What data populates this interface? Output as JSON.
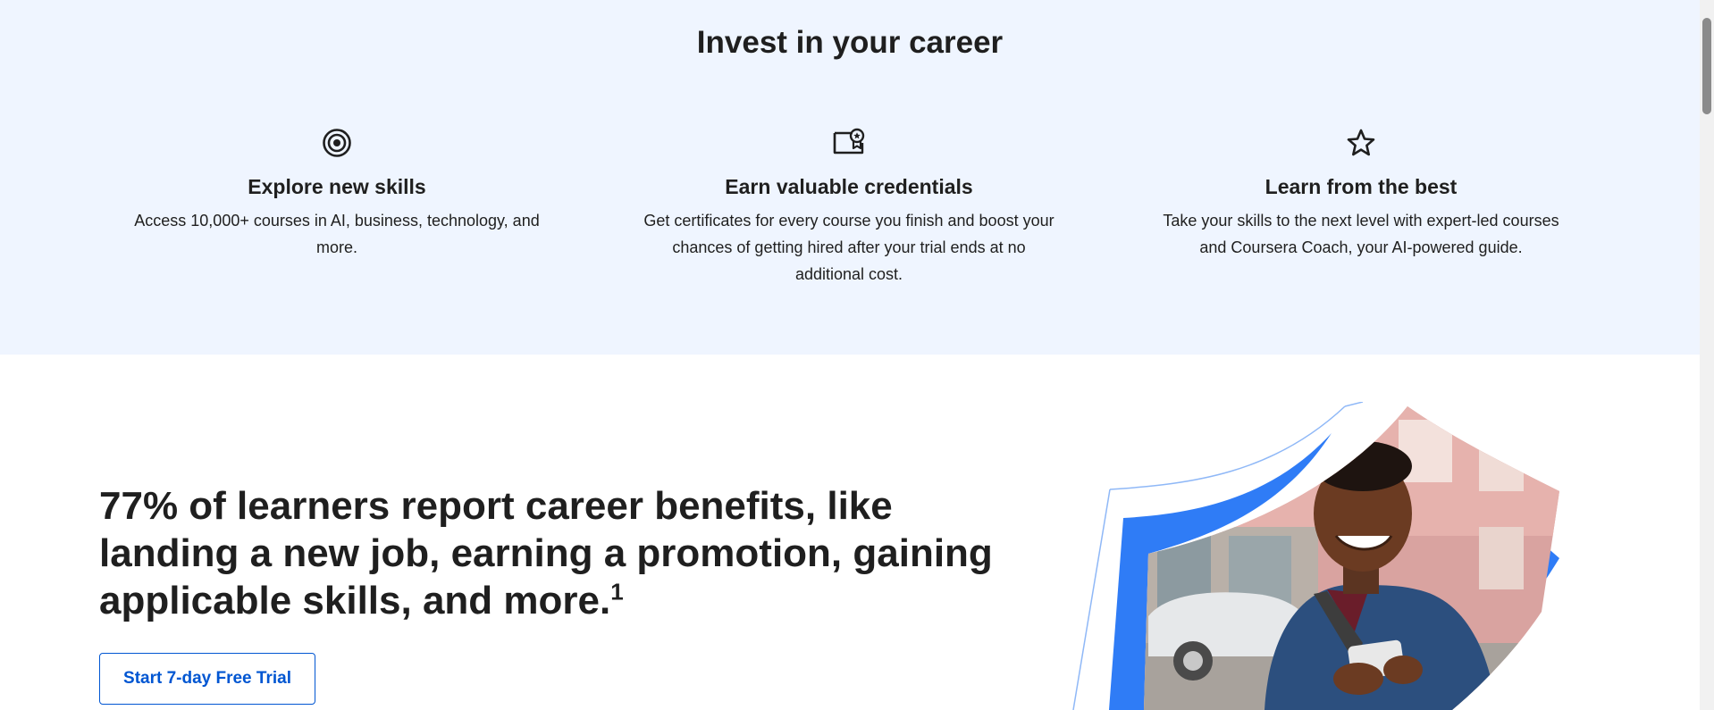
{
  "invest": {
    "title": "Invest in your career",
    "features": [
      {
        "icon": "target-icon",
        "title": "Explore new skills",
        "description": "Access 10,000+ courses in AI, business, technology, and more."
      },
      {
        "icon": "certificate-icon",
        "title": "Earn valuable credentials",
        "description": "Get certificates for every course you finish and boost your chances of getting hired after your trial ends at no additional cost."
      },
      {
        "icon": "star-icon",
        "title": "Learn from the best",
        "description": "Take your skills to the next level with expert-led courses and Coursera Coach, your AI-powered guide."
      }
    ]
  },
  "benefits": {
    "headline": "77% of learners report career benefits, like landing a new job, earning a promotion, gaining applicable skills, and more.",
    "footnote_marker": "1",
    "cta_label": "Start 7-day Free Trial"
  },
  "colors": {
    "section_background": "#eff5ff",
    "brand_blue": "#0056d2",
    "accent_blue": "#2f7cf6",
    "text": "#1f1f1f"
  }
}
